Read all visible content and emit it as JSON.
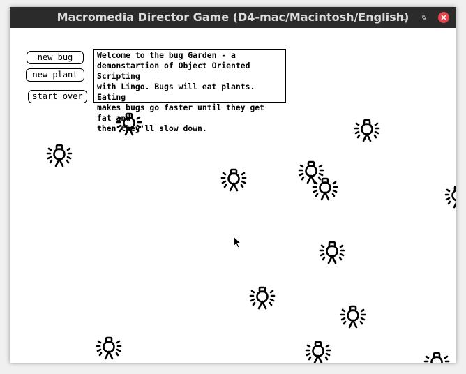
{
  "window": {
    "title": "Macromedia Director Game (D4-mac/Macintosh/English)",
    "controls": {
      "minimize_icon": "minimize-icon",
      "maximize_icon": "maximize-icon",
      "close_icon": "close-icon",
      "close_color": "#e0454b"
    }
  },
  "stage": {
    "buttons": {
      "new_bug": "new bug",
      "new_plant": "new plant",
      "start_over": "start over"
    },
    "info_text": "Welcome to the bug Garden - a\ndemonstartion of Object Oriented Scripting\nwith Lingo. Bugs will eat plants. Eating\nmakes bugs go faster until they get fat and\nthen they'll slow down.",
    "sprite_icon": "bug-icon",
    "pointer_icon": "mouse-pointer-icon"
  }
}
